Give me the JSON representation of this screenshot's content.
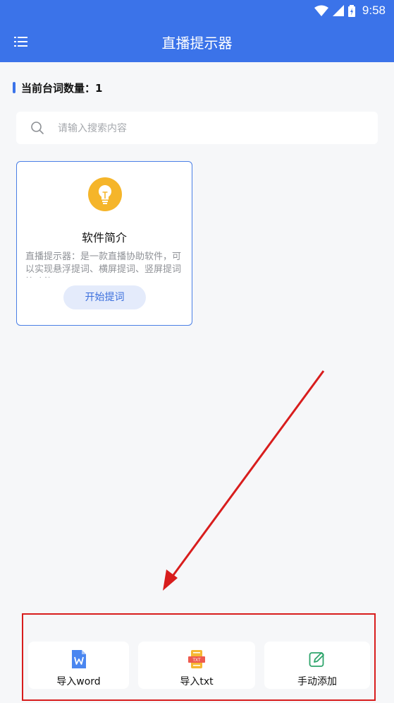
{
  "status_bar": {
    "time": "9:58"
  },
  "app_bar": {
    "title": "直播提示器"
  },
  "count": {
    "label": "当前台词数量：1"
  },
  "search": {
    "placeholder": "请输入搜索内容"
  },
  "card": {
    "title": "软件简介",
    "description": "直播提示器：是一款直播协助软件，可以实现悬浮提词、横屏提词、竖屏提词等功能",
    "button": "开始提词"
  },
  "actions": [
    {
      "label": "导入word",
      "icon": "word-file-icon"
    },
    {
      "label": "导入txt",
      "icon": "txt-file-icon"
    },
    {
      "label": "手动添加",
      "icon": "edit-icon"
    }
  ],
  "colors": {
    "primary": "#3b73e9",
    "annotation": "#d81d1d",
    "bulb": "#f5b52a"
  }
}
